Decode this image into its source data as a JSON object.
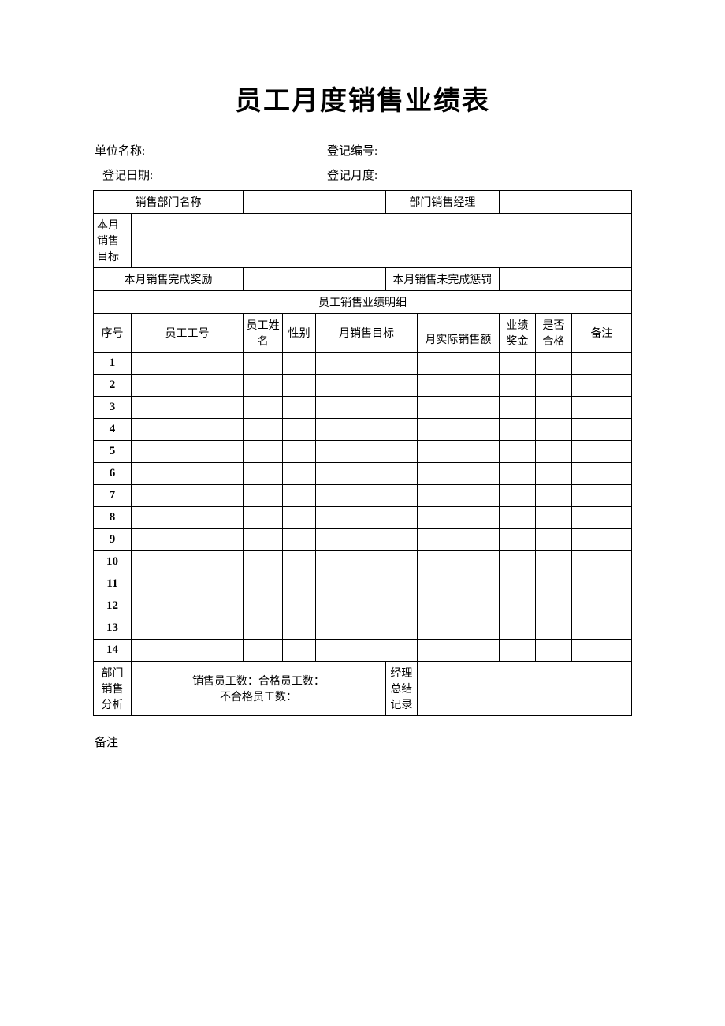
{
  "title": "员工月度销售业绩表",
  "meta": {
    "unit_label": "单位名称:",
    "reg_no_label": "登记编号:",
    "reg_date_label": "登记日期:",
    "reg_month_label": "登记月度:"
  },
  "row_dept": {
    "dept_name_label": "销售部门名称",
    "dept_manager_label": "部门销售经理"
  },
  "row_target": {
    "month_target_label": "本月销售目标"
  },
  "row_bonus": {
    "bonus_label": "本月销售完成奖励",
    "penalty_label": "本月销售未完成惩罚"
  },
  "detail_header": "员工销售业绩明细",
  "columns": {
    "seq": "序号",
    "emp_no": "员工工号",
    "emp_name": "员工姓名",
    "gender": "性别",
    "month_target": "月销售目标",
    "month_actual": "月实际销售额",
    "bonus": "业绩奖金",
    "qualified": "是否合格",
    "remark": "备注"
  },
  "rows": [
    {
      "seq": "1"
    },
    {
      "seq": "2"
    },
    {
      "seq": "3"
    },
    {
      "seq": "4"
    },
    {
      "seq": "5"
    },
    {
      "seq": "6"
    },
    {
      "seq": "7"
    },
    {
      "seq": "8"
    },
    {
      "seq": "9"
    },
    {
      "seq": "10"
    },
    {
      "seq": "11"
    },
    {
      "seq": "12"
    },
    {
      "seq": "13"
    },
    {
      "seq": "14"
    }
  ],
  "analysis": {
    "dept_analysis_label": "部门销售分析",
    "sales_count_label": "销售员工数：",
    "qualified_count_label": "合格员工数：",
    "unqualified_count_label": "不合格员工数：",
    "manager_summary_label": "经理总结记录"
  },
  "footer_note": "备注"
}
